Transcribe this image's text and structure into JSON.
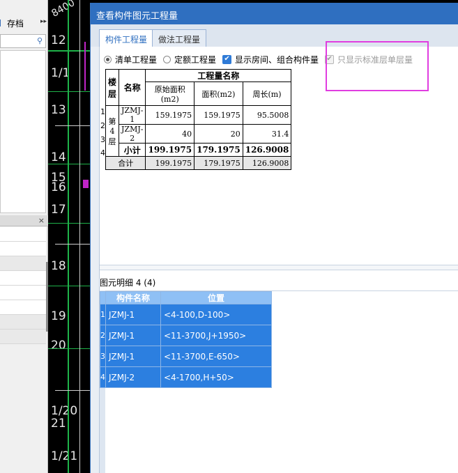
{
  "left_panel": {
    "save_label": "存档"
  },
  "cad": {
    "axis_numbers": [
      "12",
      "1/1",
      "13",
      "14",
      "15",
      "16",
      "17",
      "18",
      "19",
      "20",
      "1/20",
      "21",
      "1/21"
    ],
    "top_text": "8400"
  },
  "dialog": {
    "title": "查看构件图元工程量",
    "tabs": [
      "构件工程量",
      "做法工程量"
    ],
    "options": {
      "list_qty": "清单工程量",
      "quota_qty": "定额工程量",
      "show_rooms": "显示房间、组合构件量",
      "std_floor_only": "只显示标准层单层量"
    },
    "qty_table": {
      "headers": {
        "floor": "楼层",
        "name": "名称",
        "group": "工程量名称",
        "orig_area": "原始面积(m2)",
        "area": "面积(m2)",
        "perimeter": "周长(m)"
      },
      "floor_name": "第4层",
      "row_numbers": [
        "1",
        "2",
        "3",
        "4"
      ],
      "rows": [
        {
          "name": "JZMJ-1",
          "orig_area": "159.1975",
          "area": "159.1975",
          "perimeter": "95.5008"
        },
        {
          "name": "JZMJ-2",
          "orig_area": "40",
          "area": "20",
          "perimeter": "31.4"
        }
      ],
      "subtotal": {
        "label": "小计",
        "orig_area": "199.1975",
        "area": "179.1975",
        "perimeter": "126.9008"
      },
      "total": {
        "label": "合计",
        "orig_area": "199.1975",
        "area": "179.1975",
        "perimeter": "126.9008"
      }
    },
    "detail": {
      "label": "图元明细  4 (4)",
      "headers": {
        "name": "构件名称",
        "position": "位置"
      },
      "rows": [
        {
          "num": "1",
          "name": "JZMJ-1",
          "position": "<4-100,D-100>"
        },
        {
          "num": "2",
          "name": "JZMJ-1",
          "position": "<11-3700,J+1950>"
        },
        {
          "num": "3",
          "name": "JZMJ-1",
          "position": "<11-3700,E-650>"
        },
        {
          "num": "4",
          "name": "JZMJ-2",
          "position": "<4-1700,H+50>"
        }
      ]
    }
  },
  "colors": {
    "title_bar": "#2f6fc0",
    "detail_row": "#2c7fe0",
    "detail_header": "#8fc0f5",
    "highlight_box": "#e03de0"
  }
}
